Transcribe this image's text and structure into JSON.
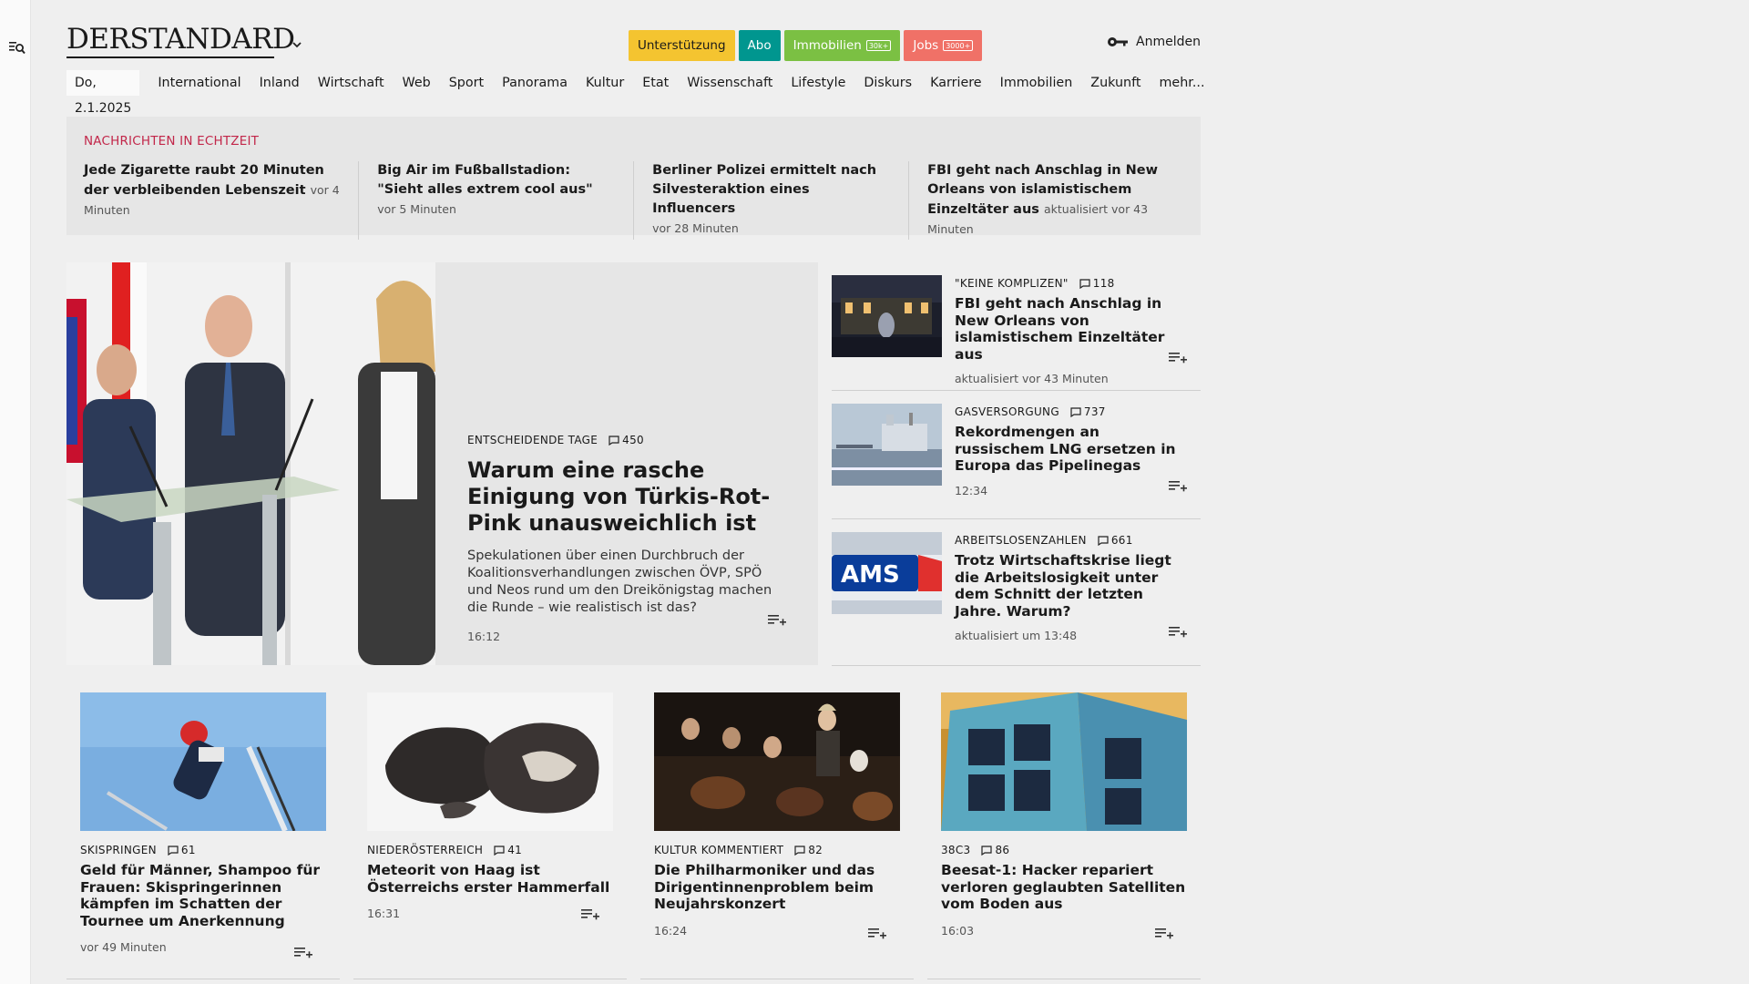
{
  "brand": {
    "logo": "DERSTANDARD"
  },
  "header": {
    "pills": [
      {
        "label": "Unterstützung",
        "bg": "#f4c430",
        "fg": "#1a1a1a",
        "badge": ""
      },
      {
        "label": "Abo",
        "bg": "#00968f",
        "fg": "#ffffff",
        "badge": ""
      },
      {
        "label": "Immobilien",
        "bg": "#7bc043",
        "fg": "#ffffff",
        "badge": "30k+"
      },
      {
        "label": "Jobs",
        "bg": "#f07167",
        "fg": "#ffffff",
        "badge": "3000+"
      }
    ],
    "login": "Anmelden"
  },
  "nav": {
    "date": "Do, 2.1.2025",
    "items": [
      "International",
      "Inland",
      "Wirtschaft",
      "Web",
      "Sport",
      "Panorama",
      "Kultur",
      "Etat",
      "Wissenschaft",
      "Lifestyle",
      "Diskurs",
      "Karriere",
      "Immobilien",
      "Zukunft",
      "mehr..."
    ]
  },
  "ticker": {
    "title": "NACHRICHTEN IN ECHTZEIT",
    "items": [
      {
        "headline": "Jede Zigarette raubt 20 Minuten der verbleibenden Lebenszeit",
        "time": "vor 4 Minuten"
      },
      {
        "headline": "Big Air im Fußballstadion: \"Sieht alles extrem cool aus\"",
        "time": "vor 5 Minuten"
      },
      {
        "headline": "Berliner Polizei ermittelt nach Silves­teraktion eines Influencers",
        "time": "vor 28 Minuten"
      },
      {
        "headline": "FBI geht nach Anschlag in New Or­leans von islamistischem Einzeltäter aus",
        "time": "aktualisiert vor 43 Minuten"
      }
    ]
  },
  "lead": {
    "kicker": "ENTSCHEIDENDE TAGE",
    "comments": "450",
    "title": "Warum eine rasche Einigung von Türkis-Rot-Pink unausweichlich ist",
    "teaser": "Spekulationen über einen Durchbruch der Koaliti­onsverhandlungen zwischen ÖVP, SPÖ und Neos rund um den Dreikönigstag machen die Runde – wie realistisch ist das?",
    "time": "16:12"
  },
  "side": [
    {
      "kicker": "\"KEINE KOMPLIZEN\"",
      "comments": "118",
      "title": "FBI geht nach Anschlag in New Orleans von islamistischem Einzeltäter aus",
      "time": "aktualisiert vor 43 Minuten"
    },
    {
      "kicker": "GASVERSORGUNG",
      "comments": "737",
      "title": "Rekordmengen an russischem LNG ersetzen in Europa das Pipelinegas",
      "time": "12:34"
    },
    {
      "kicker": "ARBEITSLOSENZAHLEN",
      "comments": "661",
      "title": "Trotz Wirtschaftskrise liegt die Arbeitslosigkeit unter dem Schnitt der letzten Jahre. Warum?",
      "time": "aktualisiert um 13:48",
      "img_text": "AMS"
    }
  ],
  "cards": [
    {
      "kicker": "SKISPRINGEN",
      "comments": "61",
      "title": "Geld für Männer, Shampoo für Frauen: Skispringerinnen kämpfen im Schatten der Tournee um Anerkennung",
      "time": "vor 49 Minuten"
    },
    {
      "kicker": "NIEDERÖSTERREICH",
      "comments": "41",
      "title": "Meteorit von Haag ist Österreichs erster Hammerfall",
      "time": "16:31"
    },
    {
      "kicker": "KULTUR KOMMENTIERT",
      "comments": "82",
      "title": "Die Philharmoniker und das Diri­gentinnenproblem beim Neujahrs­konzert",
      "time": "16:24"
    },
    {
      "kicker": "38C3",
      "comments": "86",
      "title": "Beesat-1: Hacker repariert verloren geglaubten Satelliten vom Boden aus",
      "time": "16:03"
    }
  ],
  "colors": {
    "accent": "#c2274a",
    "background": "#efefef",
    "panel": "#e6e6e6"
  }
}
